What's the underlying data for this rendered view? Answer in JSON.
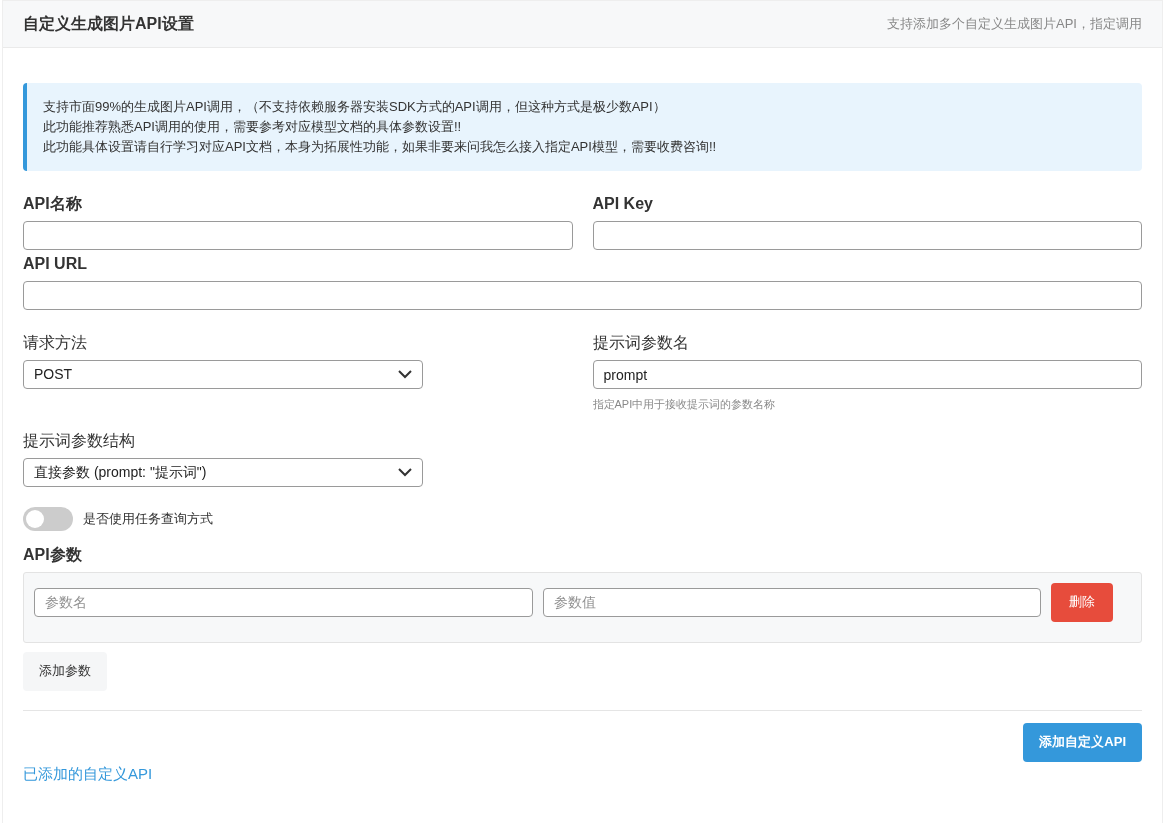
{
  "header": {
    "title": "自定义生成图片API设置",
    "subtitle": "支持添加多个自定义生成图片API，指定调用"
  },
  "notice": [
    "支持市面99%的生成图片API调用，（不支持依赖服务器安装SDK方式的API调用，但这种方式是极少数API）",
    "此功能推荐熟悉API调用的使用，需要参考对应模型文档的具体参数设置!!",
    "此功能具体设置请自行学习对应API文档，本身为拓展性功能，如果非要来问我怎么接入指定API模型，需要收费咨询!!"
  ],
  "api_name": {
    "label": "API名称"
  },
  "api_key": {
    "label": "API Key"
  },
  "api_url": {
    "label": "API URL"
  },
  "request_method": {
    "label": "请求方法",
    "value": "POST"
  },
  "prompt_param": {
    "label": "提示词参数名",
    "value": "prompt",
    "help": "指定API中用于接收提示词的参数名称"
  },
  "prompt_structure": {
    "label": "提示词参数结构",
    "value": "直接参数 (prompt: \"提示词\")"
  },
  "task_query": {
    "label": "是否使用任务查询方式",
    "on": false
  },
  "api_params": {
    "label": "API参数",
    "rows": [
      {
        "name_placeholder": "参数名",
        "value_placeholder": "参数值",
        "delete": "删除"
      }
    ],
    "add": "添加参数"
  },
  "submit": "添加自定义API",
  "added_title": "已添加的自定义API"
}
